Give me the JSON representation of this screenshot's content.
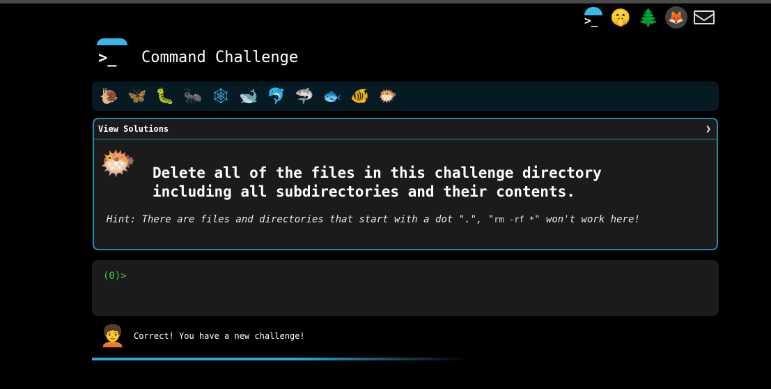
{
  "header": {
    "title": "Command Challenge",
    "logo_glyph": ">_"
  },
  "top_icons": [
    {
      "name": "terminal-logo-icon",
      "glyph": ">_"
    },
    {
      "name": "shushing-face-icon",
      "glyph": "🤫"
    },
    {
      "name": "evergreen-tree-icon",
      "glyph": "🌲"
    },
    {
      "name": "gitlab-icon",
      "glyph": "🦊"
    },
    {
      "name": "envelope-icon",
      "glyph": ""
    }
  ],
  "progress_emojis": [
    {
      "name": "snail-icon",
      "glyph": "🐌"
    },
    {
      "name": "butterfly-icon",
      "glyph": "🦋"
    },
    {
      "name": "caterpillar-icon",
      "glyph": "🐛"
    },
    {
      "name": "ant-icon",
      "glyph": "🐜"
    },
    {
      "name": "spider-web-icon",
      "glyph": "🕸"
    },
    {
      "name": "whale-icon",
      "glyph": "🐋"
    },
    {
      "name": "dolphin-icon",
      "glyph": "🐬"
    },
    {
      "name": "shark-icon",
      "glyph": "🦈"
    },
    {
      "name": "fish-icon",
      "glyph": "🐟"
    },
    {
      "name": "tropical-fish-icon",
      "glyph": "🐠"
    },
    {
      "name": "blowfish-icon",
      "glyph": "🐡"
    }
  ],
  "panel": {
    "header": "View Solutions",
    "chevron": "❯",
    "fish_glyph": "🐡",
    "challenge_line1": "Delete all of the files in this challenge directory",
    "challenge_line2": "including all subdirectories and their contents.",
    "hint_prefix": "Hint: There are files and directories that start with a dot \".\", \"",
    "hint_code": "rm -rf *",
    "hint_suffix": "\" won't work here!"
  },
  "terminal": {
    "prompt": "(0)>",
    "value": ""
  },
  "status": {
    "avatar_glyph": "🧑‍🦱",
    "message": "Correct! You have a new challenge!"
  },
  "colors": {
    "accent": "#3cb6e4",
    "panel_border": "#1f8fb0",
    "prompt_green": "#3ccc3c"
  }
}
